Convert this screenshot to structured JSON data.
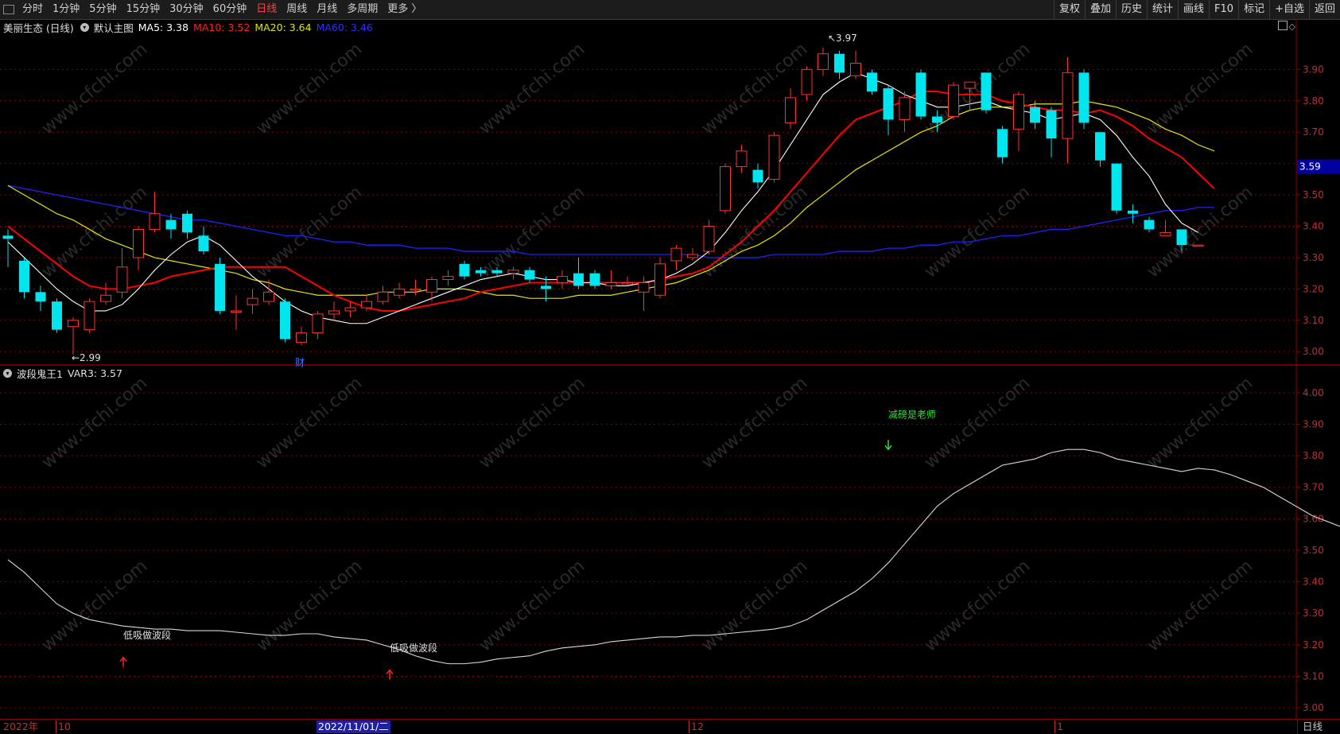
{
  "toolbar": {
    "periods": [
      "分时",
      "1分钟",
      "5分钟",
      "15分钟",
      "30分钟",
      "60分钟",
      "日线",
      "周线",
      "月线",
      "多周期",
      "更多 〉"
    ],
    "active_period": "日线",
    "right_buttons": [
      "复权",
      "叠加",
      "历史",
      "统计",
      "画线",
      "F10",
      "标记",
      "+自选",
      "返回"
    ]
  },
  "main_legend": {
    "stock": "美丽生态 (日线)",
    "template": "默认主图",
    "ma5": "MA5: 3.38",
    "ma10": "MA10: 3.52",
    "ma20": "MA20: 3.64",
    "ma60": "MA60: 3.46"
  },
  "sub_legend": {
    "indicator": "波段鬼王1",
    "var3": "VAR3: 3.57"
  },
  "annotations": {
    "high": "3.97",
    "low": "2.99",
    "fin_marker": "财",
    "buy1": "低吸做波段",
    "buy2": "低吸做波段",
    "sell": "减磅是老师"
  },
  "current_price_tag": "3.59",
  "bottom": {
    "year": "2022年",
    "m10": "10",
    "cursor_date": "2022/11/01/二",
    "m12": "12",
    "m1": "1",
    "period": "日线"
  },
  "watermark": "www.cfchi.com",
  "colors": {
    "up": "#ff3030",
    "down": "#00e5ee",
    "ma5": "#ffffff",
    "ma10": "#ff0000",
    "ma20": "#e6e600",
    "ma60": "#2020ff",
    "grid": "#8b0000",
    "axis_text": "#c03030"
  },
  "chart_data": [
    {
      "type": "candlestick",
      "title": "美丽生态 (日线)",
      "y_ticks": [
        3.0,
        3.1,
        3.2,
        3.3,
        3.4,
        3.5,
        3.6,
        3.7,
        3.8,
        3.9
      ],
      "ylim": [
        2.96,
        4.01
      ],
      "candles": [
        [
          3.37,
          3.36,
          3.39,
          3.27
        ],
        [
          3.29,
          3.19,
          3.3,
          3.17
        ],
        [
          3.19,
          3.16,
          3.21,
          3.13
        ],
        [
          3.16,
          3.07,
          3.17,
          3.06
        ],
        [
          3.08,
          3.1,
          3.11,
          2.99
        ],
        [
          3.07,
          3.16,
          3.17,
          3.06
        ],
        [
          3.16,
          3.18,
          3.22,
          3.15
        ],
        [
          3.19,
          3.27,
          3.33,
          3.17
        ],
        [
          3.3,
          3.39,
          3.4,
          3.26
        ],
        [
          3.39,
          3.44,
          3.51,
          3.38
        ],
        [
          3.42,
          3.39,
          3.44,
          3.36
        ],
        [
          3.44,
          3.38,
          3.45,
          3.36
        ],
        [
          3.37,
          3.32,
          3.4,
          3.31
        ],
        [
          3.28,
          3.13,
          3.3,
          3.12
        ],
        [
          3.13,
          3.13,
          3.18,
          3.07
        ],
        [
          3.15,
          3.17,
          3.2,
          3.12
        ],
        [
          3.16,
          3.19,
          3.23,
          3.15
        ],
        [
          3.16,
          3.04,
          3.17,
          3.03
        ],
        [
          3.03,
          3.06,
          3.08,
          3.02
        ],
        [
          3.06,
          3.12,
          3.13,
          3.04
        ],
        [
          3.12,
          3.13,
          3.16,
          3.1
        ],
        [
          3.13,
          3.14,
          3.16,
          3.11
        ],
        [
          3.14,
          3.16,
          3.18,
          3.13
        ],
        [
          3.16,
          3.19,
          3.21,
          3.15
        ],
        [
          3.18,
          3.2,
          3.22,
          3.17
        ],
        [
          3.2,
          3.2,
          3.23,
          3.18
        ],
        [
          3.19,
          3.23,
          3.24,
          3.16
        ],
        [
          3.23,
          3.24,
          3.26,
          3.21
        ],
        [
          3.28,
          3.24,
          3.29,
          3.23
        ],
        [
          3.26,
          3.25,
          3.27,
          3.24
        ],
        [
          3.26,
          3.25,
          3.27,
          3.24
        ],
        [
          3.25,
          3.26,
          3.27,
          3.23
        ],
        [
          3.26,
          3.23,
          3.27,
          3.22
        ],
        [
          3.21,
          3.2,
          3.24,
          3.16
        ],
        [
          3.22,
          3.24,
          3.26,
          3.2
        ],
        [
          3.25,
          3.21,
          3.3,
          3.2
        ],
        [
          3.25,
          3.21,
          3.26,
          3.2
        ],
        [
          3.21,
          3.22,
          3.26,
          3.2
        ],
        [
          3.22,
          3.22,
          3.24,
          3.21
        ],
        [
          3.19,
          3.22,
          3.24,
          3.13
        ],
        [
          3.18,
          3.28,
          3.3,
          3.17
        ],
        [
          3.29,
          3.33,
          3.34,
          3.26
        ],
        [
          3.3,
          3.31,
          3.33,
          3.29
        ],
        [
          3.32,
          3.4,
          3.42,
          3.31
        ],
        [
          3.45,
          3.59,
          3.6,
          3.44
        ],
        [
          3.59,
          3.64,
          3.66,
          3.57
        ],
        [
          3.58,
          3.54,
          3.6,
          3.52
        ],
        [
          3.55,
          3.69,
          3.7,
          3.54
        ],
        [
          3.73,
          3.81,
          3.84,
          3.71
        ],
        [
          3.82,
          3.9,
          3.91,
          3.8
        ],
        [
          3.9,
          3.95,
          3.97,
          3.88
        ],
        [
          3.95,
          3.89,
          3.96,
          3.87
        ],
        [
          3.88,
          3.92,
          3.96,
          3.87
        ],
        [
          3.89,
          3.83,
          3.9,
          3.82
        ],
        [
          3.84,
          3.74,
          3.85,
          3.69
        ],
        [
          3.74,
          3.81,
          3.83,
          3.7
        ],
        [
          3.89,
          3.75,
          3.9,
          3.74
        ],
        [
          3.75,
          3.73,
          3.77,
          3.7
        ],
        [
          3.75,
          3.85,
          3.86,
          3.74
        ],
        [
          3.84,
          3.86,
          3.86,
          3.77
        ],
        [
          3.89,
          3.77,
          3.89,
          3.76
        ],
        [
          3.71,
          3.62,
          3.72,
          3.6
        ],
        [
          3.71,
          3.82,
          3.83,
          3.64
        ],
        [
          3.78,
          3.73,
          3.8,
          3.71
        ],
        [
          3.77,
          3.68,
          3.78,
          3.62
        ],
        [
          3.68,
          3.89,
          3.94,
          3.6
        ],
        [
          3.89,
          3.73,
          3.9,
          3.71
        ],
        [
          3.7,
          3.61,
          3.7,
          3.59
        ],
        [
          3.6,
          3.45,
          3.6,
          3.44
        ],
        [
          3.45,
          3.44,
          3.47,
          3.41
        ],
        [
          3.42,
          3.39,
          3.43,
          3.38
        ],
        [
          3.37,
          3.38,
          3.42,
          3.37
        ],
        [
          3.39,
          3.34,
          3.39,
          3.32
        ],
        [
          3.34,
          3.34,
          3.34,
          3.34
        ]
      ],
      "ma5": [
        3.35,
        3.3,
        3.25,
        3.2,
        3.16,
        3.13,
        3.13,
        3.15,
        3.2,
        3.26,
        3.31,
        3.35,
        3.37,
        3.34,
        3.29,
        3.24,
        3.2,
        3.16,
        3.13,
        3.11,
        3.1,
        3.09,
        3.09,
        3.11,
        3.13,
        3.15,
        3.17,
        3.19,
        3.21,
        3.23,
        3.24,
        3.25,
        3.24,
        3.23,
        3.23,
        3.22,
        3.22,
        3.21,
        3.21,
        3.22,
        3.23,
        3.25,
        3.28,
        3.32,
        3.38,
        3.45,
        3.51,
        3.58,
        3.66,
        3.74,
        3.82,
        3.86,
        3.89,
        3.87,
        3.85,
        3.82,
        3.8,
        3.78,
        3.78,
        3.79,
        3.8,
        3.78,
        3.77,
        3.76,
        3.74,
        3.75,
        3.76,
        3.74,
        3.69,
        3.62,
        3.56,
        3.47,
        3.41,
        3.38
      ],
      "ma10": [
        3.4,
        3.36,
        3.32,
        3.28,
        3.24,
        3.21,
        3.2,
        3.2,
        3.21,
        3.22,
        3.24,
        3.25,
        3.26,
        3.27,
        3.27,
        3.27,
        3.27,
        3.27,
        3.24,
        3.21,
        3.18,
        3.16,
        3.14,
        3.13,
        3.13,
        3.14,
        3.15,
        3.16,
        3.17,
        3.19,
        3.2,
        3.21,
        3.22,
        3.22,
        3.22,
        3.22,
        3.22,
        3.22,
        3.22,
        3.22,
        3.23,
        3.24,
        3.25,
        3.27,
        3.31,
        3.35,
        3.4,
        3.45,
        3.51,
        3.57,
        3.63,
        3.69,
        3.74,
        3.76,
        3.78,
        3.8,
        3.83,
        3.83,
        3.82,
        3.82,
        3.82,
        3.8,
        3.79,
        3.78,
        3.77,
        3.77,
        3.76,
        3.77,
        3.75,
        3.72,
        3.68,
        3.65,
        3.62,
        3.57,
        3.52
      ],
      "ma20": [
        3.53,
        3.5,
        3.47,
        3.44,
        3.42,
        3.39,
        3.36,
        3.34,
        3.32,
        3.3,
        3.29,
        3.28,
        3.27,
        3.26,
        3.25,
        3.23,
        3.22,
        3.2,
        3.19,
        3.18,
        3.18,
        3.18,
        3.18,
        3.19,
        3.19,
        3.19,
        3.2,
        3.2,
        3.2,
        3.19,
        3.18,
        3.18,
        3.17,
        3.17,
        3.17,
        3.18,
        3.18,
        3.18,
        3.19,
        3.2,
        3.21,
        3.22,
        3.24,
        3.26,
        3.29,
        3.32,
        3.34,
        3.37,
        3.41,
        3.46,
        3.5,
        3.54,
        3.58,
        3.61,
        3.64,
        3.67,
        3.7,
        3.72,
        3.75,
        3.77,
        3.78,
        3.78,
        3.78,
        3.79,
        3.79,
        3.79,
        3.8,
        3.79,
        3.78,
        3.76,
        3.74,
        3.71,
        3.69,
        3.66,
        3.64
      ],
      "ma60": [
        3.53,
        3.52,
        3.51,
        3.5,
        3.49,
        3.48,
        3.47,
        3.46,
        3.45,
        3.44,
        3.43,
        3.42,
        3.42,
        3.41,
        3.4,
        3.39,
        3.38,
        3.37,
        3.37,
        3.36,
        3.35,
        3.35,
        3.34,
        3.34,
        3.34,
        3.33,
        3.33,
        3.33,
        3.32,
        3.32,
        3.32,
        3.32,
        3.31,
        3.31,
        3.31,
        3.31,
        3.31,
        3.31,
        3.31,
        3.31,
        3.31,
        3.31,
        3.31,
        3.3,
        3.3,
        3.3,
        3.3,
        3.31,
        3.31,
        3.31,
        3.31,
        3.32,
        3.32,
        3.32,
        3.33,
        3.33,
        3.34,
        3.34,
        3.35,
        3.35,
        3.36,
        3.37,
        3.37,
        3.38,
        3.39,
        3.39,
        3.4,
        3.41,
        3.42,
        3.43,
        3.44,
        3.45,
        3.45,
        3.46,
        3.46
      ]
    },
    {
      "type": "line",
      "title": "波段鬼王1",
      "y_ticks": [
        3.0,
        3.1,
        3.2,
        3.3,
        3.4,
        3.5,
        3.6,
        3.7,
        3.8,
        3.9,
        4.0
      ],
      "ylim": [
        2.97,
        4.04
      ],
      "var3": [
        3.47,
        3.43,
        3.38,
        3.33,
        3.3,
        3.28,
        3.27,
        3.26,
        3.255,
        3.25,
        3.25,
        3.245,
        3.245,
        3.245,
        3.24,
        3.235,
        3.23,
        3.23,
        3.235,
        3.235,
        3.225,
        3.22,
        3.215,
        3.2,
        3.185,
        3.165,
        3.15,
        3.14,
        3.14,
        3.145,
        3.155,
        3.16,
        3.165,
        3.18,
        3.19,
        3.195,
        3.2,
        3.21,
        3.215,
        3.22,
        3.225,
        3.225,
        3.23,
        3.23,
        3.235,
        3.24,
        3.245,
        3.25,
        3.26,
        3.28,
        3.31,
        3.34,
        3.37,
        3.41,
        3.46,
        3.52,
        3.58,
        3.64,
        3.68,
        3.71,
        3.74,
        3.77,
        3.78,
        3.79,
        3.81,
        3.82,
        3.82,
        3.81,
        3.79,
        3.78,
        3.77,
        3.76,
        3.75,
        3.76,
        3.755,
        3.74,
        3.72,
        3.7,
        3.67,
        3.64,
        3.61,
        3.59,
        3.57
      ]
    }
  ]
}
